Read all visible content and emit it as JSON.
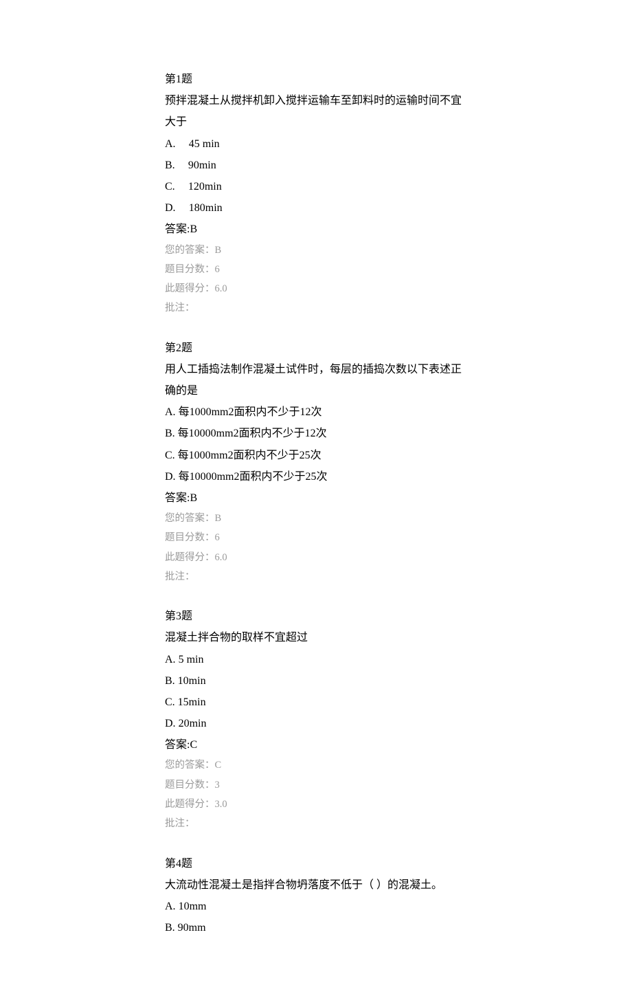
{
  "questions": [
    {
      "title": "第1题",
      "text": "预拌混凝土从搅拌机卸入搅拌运输车至卸料时的运输时间不宜大于",
      "options": [
        {
          "letter": "A.",
          "text": "45 min",
          "spaced": true
        },
        {
          "letter": "B.",
          "text": "90min",
          "spaced": true
        },
        {
          "letter": "C.",
          "text": "120min",
          "spaced": true
        },
        {
          "letter": "D.",
          "text": "180min",
          "spaced": true
        }
      ],
      "correct_answer_label": "答案:B",
      "your_answer": "您的答案：B",
      "score": "题目分数：6",
      "earned": "此题得分：6.0",
      "remark": "批注："
    },
    {
      "title": "第2题",
      "text": "用人工插捣法制作混凝土试件时，每层的插捣次数以下表述正确的是",
      "options": [
        {
          "letter": "A.",
          "text": "每1000mm2面积内不少于12次",
          "spaced": false
        },
        {
          "letter": "B.",
          "text": "每10000mm2面积内不少于12次",
          "spaced": false
        },
        {
          "letter": "C.",
          "text": "每1000mm2面积内不少于25次",
          "spaced": false
        },
        {
          "letter": "D.",
          "text": "每10000mm2面积内不少于25次",
          "spaced": false
        }
      ],
      "correct_answer_label": "答案:B",
      "your_answer": "您的答案：B",
      "score": "题目分数：6",
      "earned": "此题得分：6.0",
      "remark": "批注："
    },
    {
      "title": "第3题",
      "text": "混凝土拌合物的取样不宜超过",
      "options": [
        {
          "letter": "A.",
          "text": "5 min",
          "spaced": false
        },
        {
          "letter": "B.",
          "text": "10min",
          "spaced": false
        },
        {
          "letter": "C.",
          "text": "15min",
          "spaced": false
        },
        {
          "letter": "D.",
          "text": "20min",
          "spaced": false
        }
      ],
      "correct_answer_label": "答案:C",
      "your_answer": "您的答案：C",
      "score": "题目分数：3",
      "earned": "此题得分：3.0",
      "remark": "批注："
    },
    {
      "title": "第4题",
      "text": "大流动性混凝土是指拌合物坍落度不低于（ ）的混凝土。",
      "options": [
        {
          "letter": "A.",
          "text": "10mm",
          "spaced": false
        },
        {
          "letter": "B.",
          "text": "90mm",
          "spaced": false
        }
      ],
      "correct_answer_label": "",
      "your_answer": "",
      "score": "",
      "earned": "",
      "remark": ""
    }
  ]
}
